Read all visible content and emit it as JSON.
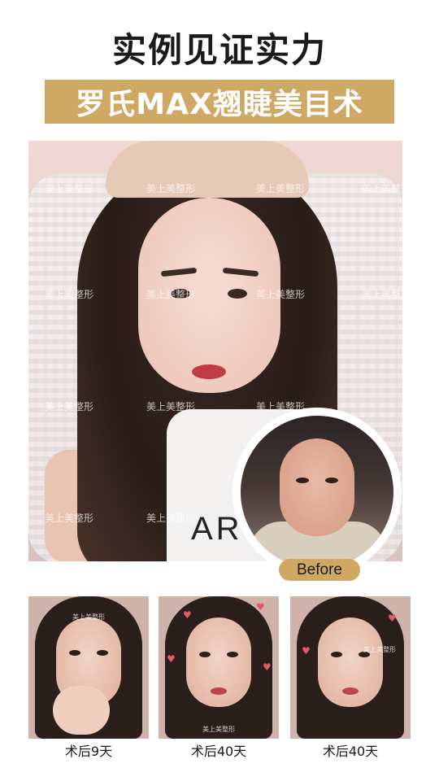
{
  "headline": "实例见证实力",
  "banner": "罗氏MAX翘睫美目术",
  "watermark": "美上美整形",
  "shirt_text": "AR",
  "before_label": "Before",
  "thumbnails": [
    {
      "caption": "术后9天"
    },
    {
      "caption": "术后40天"
    },
    {
      "caption": "术后40天"
    }
  ],
  "colors": {
    "gold": "#cfa863",
    "lip_red": "#c23a43"
  }
}
